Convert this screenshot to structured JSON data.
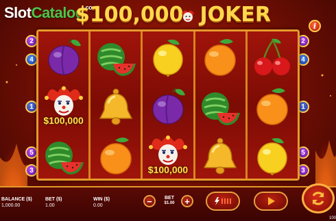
{
  "header": {
    "watermark_main": "Slot",
    "watermark_accent": "Catalog",
    "watermark_suffix": ".com",
    "title_left": "$100,000",
    "title_right": "JOKER",
    "info_icon": "i"
  },
  "paylines": {
    "left": [
      "2",
      "4",
      "1",
      "5",
      "3"
    ],
    "right": [
      "2",
      "4",
      "1",
      "5",
      "3"
    ]
  },
  "reels": [
    [
      {
        "symbol": "plum-icon"
      },
      {
        "symbol": "joker-icon",
        "prize": "$100,000"
      },
      {
        "symbol": "watermelon-icon"
      }
    ],
    [
      {
        "symbol": "watermelon-icon"
      },
      {
        "symbol": "bell-icon"
      },
      {
        "symbol": "orange-icon"
      }
    ],
    [
      {
        "symbol": "lemon-icon"
      },
      {
        "symbol": "plum-icon"
      },
      {
        "symbol": "joker-icon",
        "prize": "$100,000"
      }
    ],
    [
      {
        "symbol": "orange-icon"
      },
      {
        "symbol": "watermelon-icon"
      },
      {
        "symbol": "bell-icon"
      }
    ],
    [
      {
        "symbol": "cherry-icon"
      },
      {
        "symbol": "orange-icon"
      },
      {
        "symbol": "lemon-icon"
      }
    ]
  ],
  "footer": {
    "balance_label": "BALANCE ($)",
    "balance_value": "1,000.00",
    "bet_label": "BET ($)",
    "bet_value": "1.00",
    "win_label": "WIN ($)",
    "win_value": "0.00",
    "bet_control_label": "BET",
    "bet_control_value": "$1.00",
    "minus_icon": "−",
    "plus_icon": "+",
    "corner_text": "100"
  },
  "colors": {
    "gold": "#ffd84a",
    "frame": "#e49a2c",
    "reel_bg": "#8a1006",
    "prize_text": "#ffe14a"
  }
}
